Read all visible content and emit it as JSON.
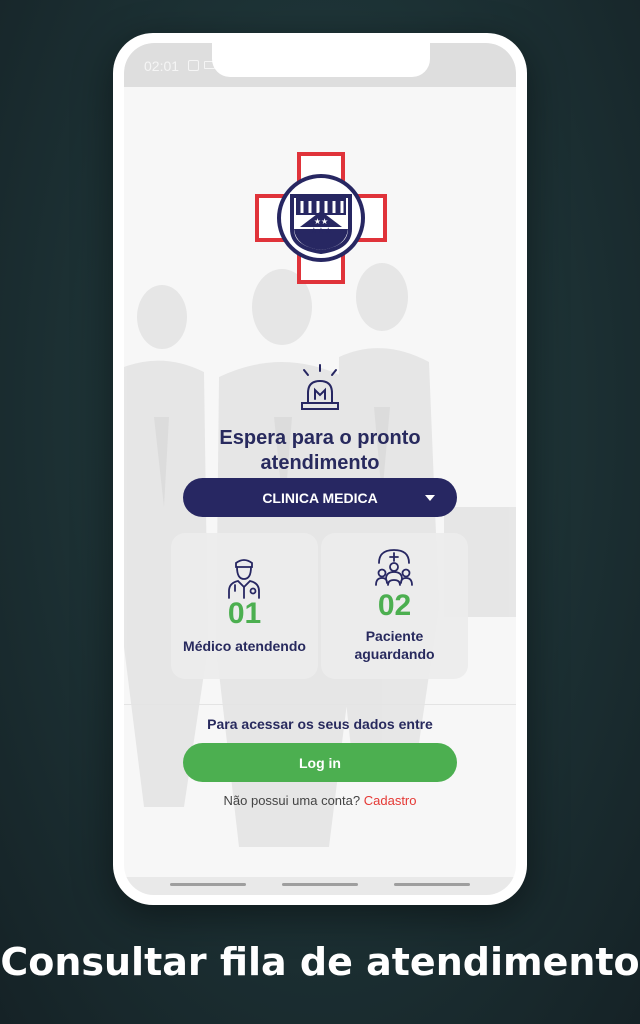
{
  "status_bar": {
    "time": "02:01"
  },
  "header": {
    "title_line1": "Espera para o pronto",
    "title_line2": "atendimento"
  },
  "specialty_select": {
    "selected": "CLINICA MEDICA"
  },
  "cards": [
    {
      "count": "01",
      "label": "Médico atendendo"
    },
    {
      "count": "02",
      "label_line1": "Paciente",
      "label_line2": "aguardando"
    }
  ],
  "access": {
    "text": "Para acessar os seus dados entre",
    "login_label": "Log in"
  },
  "signup": {
    "prompt": "Não possui uma conta?",
    "link": "Cadastro"
  },
  "caption": "Consultar fila de atendimento",
  "colors": {
    "navy": "#272762",
    "green": "#4caf50",
    "red": "#e53935",
    "logo_red": "#e0333a"
  },
  "icons": [
    "hospital-logo",
    "alarm-siren-icon",
    "doctor-icon",
    "patients-icon",
    "dropdown-caret-icon"
  ]
}
